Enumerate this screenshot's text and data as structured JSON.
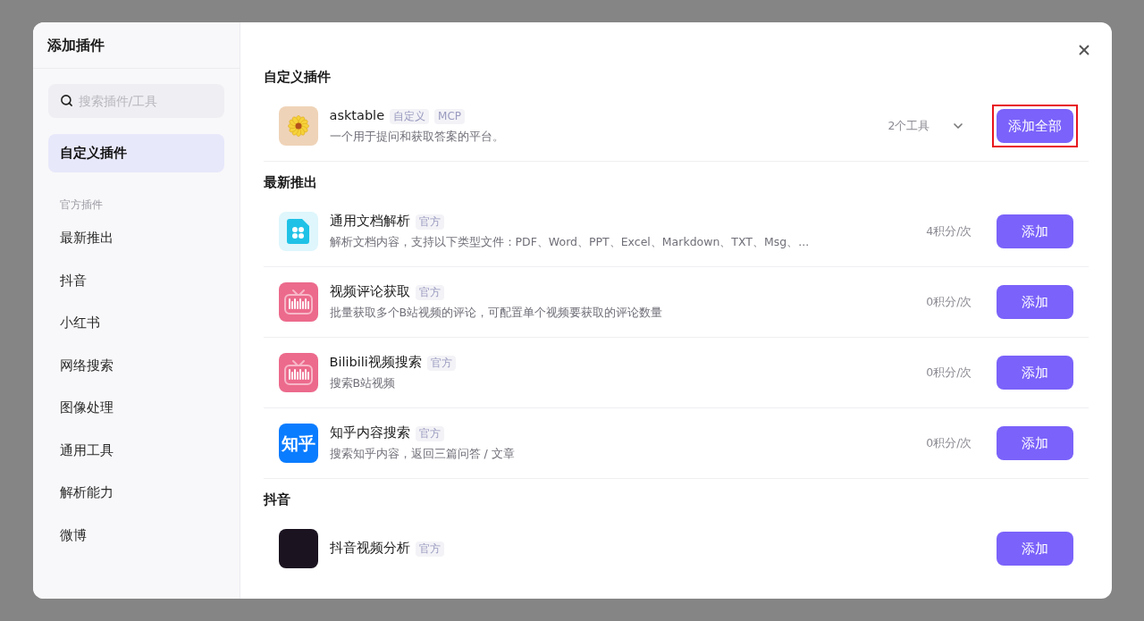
{
  "sidebar": {
    "title": "添加插件",
    "search": {
      "placeholder": "搜索插件/工具"
    },
    "items": [
      {
        "label": "自定义插件",
        "kind": "item",
        "selected": true
      },
      {
        "label": "官方插件",
        "kind": "heading"
      },
      {
        "label": "最新推出",
        "kind": "item",
        "selected": false
      },
      {
        "label": "抖音",
        "kind": "item",
        "selected": false
      },
      {
        "label": "小红书",
        "kind": "item",
        "selected": false
      },
      {
        "label": "网络搜索",
        "kind": "item",
        "selected": false
      },
      {
        "label": "图像处理",
        "kind": "item",
        "selected": false
      },
      {
        "label": "通用工具",
        "kind": "item",
        "selected": false
      },
      {
        "label": "解析能力",
        "kind": "item",
        "selected": false
      },
      {
        "label": "微博",
        "kind": "item",
        "selected": false
      }
    ]
  },
  "sections": [
    {
      "title": "自定义插件",
      "plugins": [
        {
          "name": "asktable",
          "kind": "flower",
          "tags": [
            "自定义",
            "MCP"
          ],
          "description": "一个用于提问和获取答案的平台。",
          "meta": "2个工具",
          "expandable": true,
          "button": "添加全部",
          "highlighted": true
        }
      ]
    },
    {
      "title": "最新推出",
      "plugins": [
        {
          "name": "通用文档解析",
          "kind": "document",
          "tags": [
            "官方"
          ],
          "description": "解析文档内容，支持以下类型文件：PDF、Word、PPT、Excel、Markdown、TXT、Msg、...",
          "meta": "4积分/次",
          "expandable": false,
          "button": "添加",
          "highlighted": false
        },
        {
          "name": "视频评论获取",
          "kind": "tv",
          "tags": [
            "官方"
          ],
          "description": "批量获取多个B站视频的评论，可配置单个视频要获取的评论数量",
          "meta": "0积分/次",
          "expandable": false,
          "button": "添加",
          "highlighted": false
        },
        {
          "name": "Bilibili视频搜索",
          "kind": "tv",
          "tags": [
            "官方"
          ],
          "description": "搜索B站视频",
          "meta": "0积分/次",
          "expandable": false,
          "button": "添加",
          "highlighted": false
        },
        {
          "name": "知乎内容搜索",
          "kind": "text-logo",
          "icon_text": "知乎",
          "tags": [
            "官方"
          ],
          "description": "搜索知乎内容，返回三篇问答 / 文章",
          "meta": "0积分/次",
          "expandable": false,
          "button": "添加",
          "highlighted": false
        }
      ]
    },
    {
      "title": "抖音",
      "plugins": [
        {
          "name": "抖音视频分析",
          "kind": "dark-logo",
          "tags": [
            "官方"
          ],
          "button": "添加",
          "expandable": false,
          "highlighted": false
        }
      ]
    }
  ]
}
